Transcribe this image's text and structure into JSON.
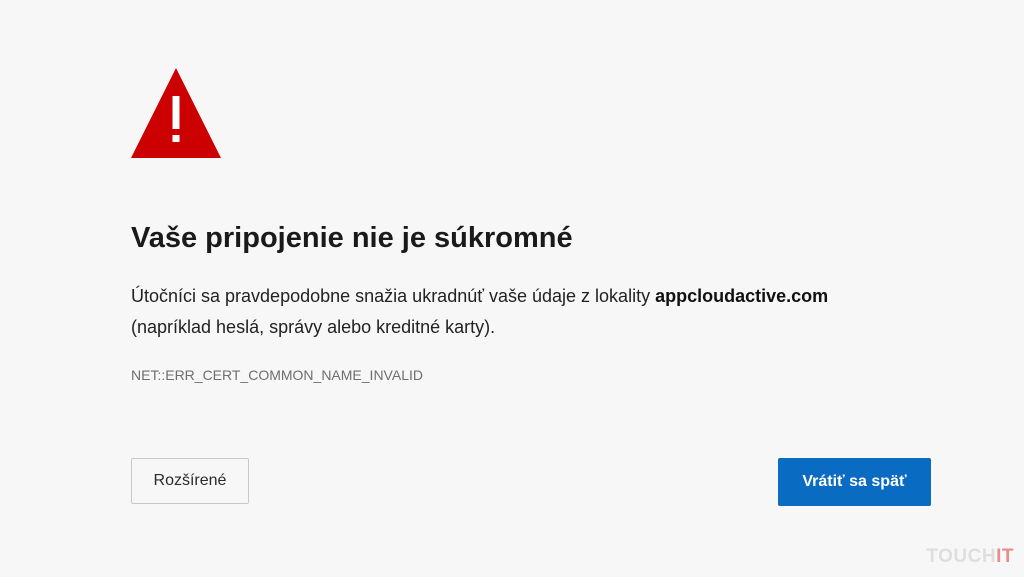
{
  "warning": {
    "icon": "warning-triangle-icon",
    "color": "#cc0000"
  },
  "title": "Vaše pripojenie nie je súkromné",
  "description": {
    "prefix": "Útočníci sa pravdepodobne snažia ukradnúť vaše údaje z lokality ",
    "host": "appcloudactive.com",
    "suffix": " (napríklad heslá, správy alebo kreditné karty)."
  },
  "error_code": "NET::ERR_CERT_COMMON_NAME_INVALID",
  "buttons": {
    "advanced_label": "Rozšírené",
    "back_label": "Vrátiť sa späť",
    "back_color": "#0a6bc2"
  },
  "watermark": {
    "main": "TOUCH",
    "accent": "IT"
  }
}
